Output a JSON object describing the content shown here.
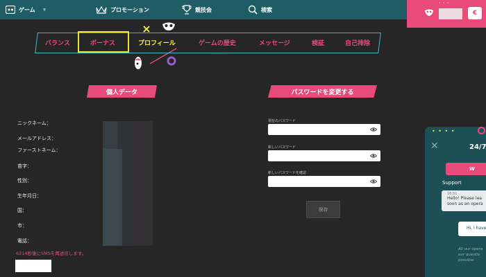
{
  "colors": {
    "nav_bar": "#1f5d66",
    "accent_pink": "#e84b7a",
    "accent_yellow": "#fff34b",
    "accent_teal": "#34c1c6",
    "background": "#262626"
  },
  "nav": {
    "items": [
      {
        "label": "ゲーム",
        "icon": "game-icon",
        "has_dropdown": true
      },
      {
        "label": "プロモーション",
        "icon": "crown-icon"
      },
      {
        "label": "競技会",
        "icon": "trophy-icon"
      },
      {
        "label": "検索",
        "icon": "search-icon"
      }
    ]
  },
  "account": {
    "dots": "· · ·",
    "wallet_label": "€"
  },
  "tabs": [
    {
      "label": "バランス",
      "active": false
    },
    {
      "label": "ボーナス",
      "active": false,
      "highlighted": true
    },
    {
      "label": "プロフィール",
      "active": true
    },
    {
      "label": "ゲームの歴史",
      "active": false
    },
    {
      "label": "メッセージ",
      "active": false
    },
    {
      "label": "検証",
      "active": false
    },
    {
      "label": "自己排除",
      "active": false
    }
  ],
  "personal": {
    "heading": "個人データ",
    "fields": [
      "ニックネーム：",
      "メールアドレス：",
      "ファーストネーム：",
      "苗字：",
      "性別：",
      "生年月日：",
      "国：",
      "市：",
      "電話："
    ],
    "resend_notice": "6214秒後にSMSを再送信します。"
  },
  "password": {
    "heading": "パスワードを変更する",
    "fields": [
      {
        "label": "現在のパスワード",
        "value": ""
      },
      {
        "label": "新しいパスワード",
        "value": ""
      },
      {
        "label": "新しいパスワードを確認",
        "value": ""
      }
    ],
    "save_label": "保存"
  },
  "chat": {
    "dots": "• • • •",
    "hours": "24/7",
    "welcome": "W",
    "support_label": "Support",
    "time": "16:51",
    "message_line1": "Hello! Please lea",
    "message_line2": "soon as an opera",
    "reply": "Hi, I have",
    "footnote_line1": "All our opera",
    "footnote_line2": "our questio",
    "footnote_line3": "possible."
  }
}
